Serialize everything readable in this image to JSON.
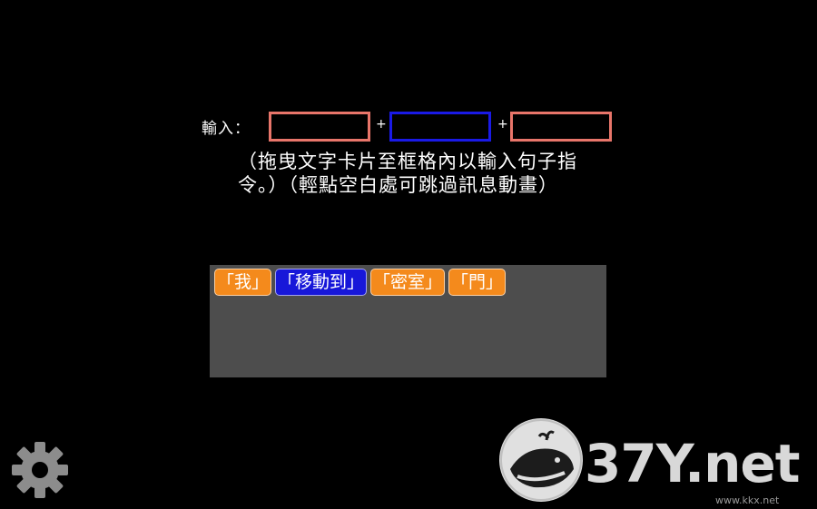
{
  "input": {
    "label": "輸入：",
    "plus_1": "+",
    "plus_2": "+"
  },
  "hint_text": "（拖曳文字卡片至框格內以輸入句子指令。）（輕點空白處可跳過訊息動畫）",
  "cards": [
    {
      "label": "「我」",
      "color": "orange"
    },
    {
      "label": "「移動到」",
      "color": "blue"
    },
    {
      "label": "「密室」",
      "color": "orange"
    },
    {
      "label": "「門」",
      "color": "orange"
    }
  ],
  "watermark": {
    "brand": "37Y.net",
    "url": "www.kkx.net"
  },
  "colors": {
    "slot_red": "#e8756a",
    "slot_blue": "#1a1ae6",
    "card_orange": "#f48a1c",
    "card_blue": "#1717d9",
    "tray": "#4d4d4d"
  },
  "icons": {
    "settings": "gear-icon"
  }
}
